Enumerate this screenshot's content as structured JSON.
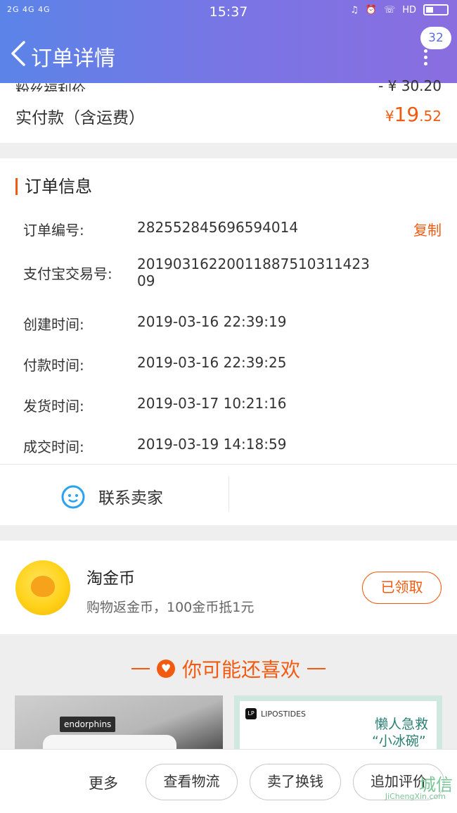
{
  "status_bar": {
    "signal": "2G 4G 4G",
    "time": "15:37",
    "hd": "HD"
  },
  "header": {
    "title": "订单详情",
    "message_count": "32"
  },
  "price": {
    "fan_label": "粉丝福利价",
    "fan_value": "- ¥ 30.20",
    "paid_label": "实付款（含运费）",
    "paid_symbol": "¥",
    "paid_integer": "19",
    "paid_decimal": ".52"
  },
  "order_info": {
    "title": "订单信息",
    "copy_label": "复制",
    "rows": [
      {
        "label": "订单编号:",
        "value": "282552845696594014"
      },
      {
        "label": "支付宝交易号:",
        "value": "20190316220011887510311423 09"
      },
      {
        "label": "创建时间:",
        "value": "2019-03-16 22:39:19"
      },
      {
        "label": "付款时间:",
        "value": "2019-03-16 22:39:25"
      },
      {
        "label": "发货时间:",
        "value": "2019-03-17 10:21:16"
      },
      {
        "label": "成交时间:",
        "value": "2019-03-19 14:18:59"
      }
    ],
    "contact_label": "联系卖家"
  },
  "coin": {
    "title": "淘金币",
    "subtitle": "购物返金币，100金币抵1元",
    "button": "已领取"
  },
  "recommend": {
    "title": "你可能还喜欢",
    "product1_tag": "endorphins",
    "product2_brand": "LIPOSTIDES",
    "product2_text1": "懒人急救",
    "product2_text2": "“小冰碗”"
  },
  "bottom_bar": {
    "more": "更多",
    "buttons": [
      "查看物流",
      "卖了换钱",
      "追加评价"
    ]
  },
  "watermark": {
    "main": "城信",
    "sub": "JiChengXin.com"
  },
  "colors": {
    "accent": "#f25b0f",
    "header_start": "#5b84e8",
    "header_end": "#8a6ee0"
  }
}
